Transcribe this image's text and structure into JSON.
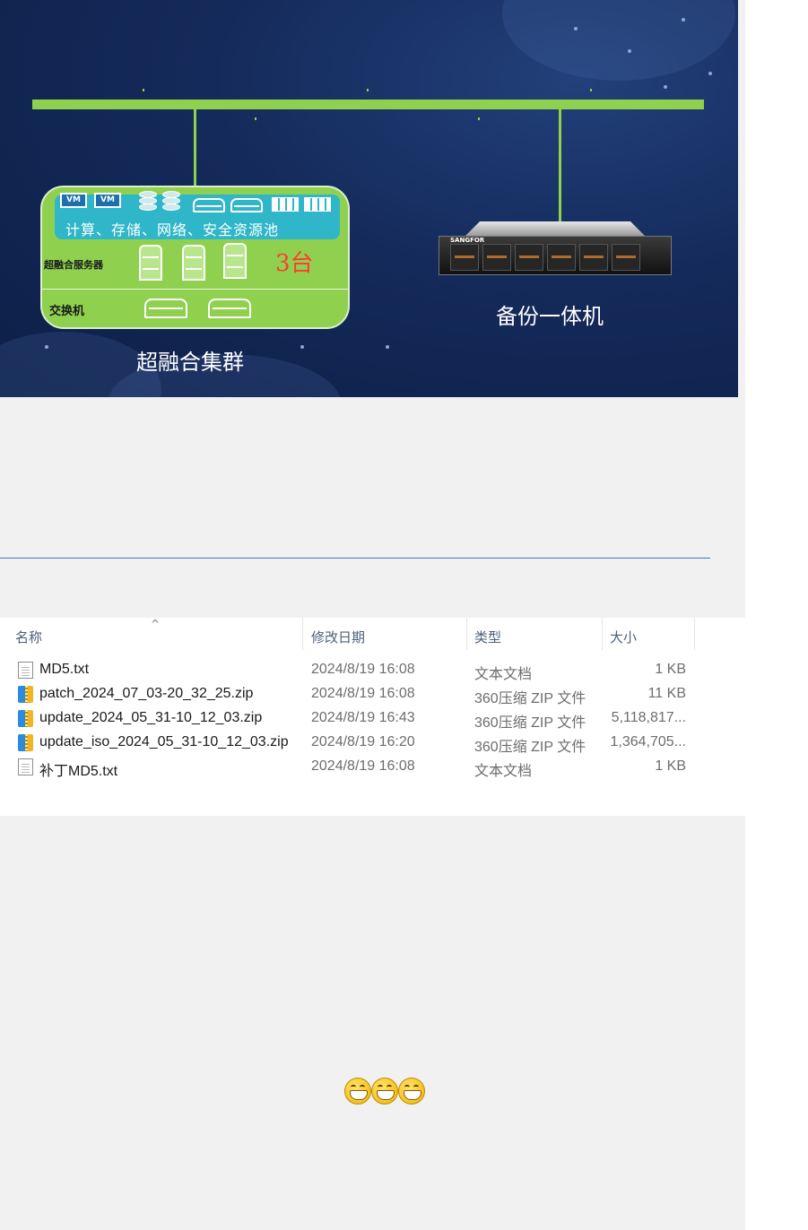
{
  "diagram": {
    "cluster": {
      "pool_label": "计算、存储、网络、安全资源池",
      "servers_label": "超融合服务器",
      "servers_count": "3台",
      "switch_label": "交换机",
      "vm_label": "VM",
      "caption": "超融合集群"
    },
    "appliance": {
      "brand": "SANGFOR",
      "caption": "备份一体机"
    },
    "colors": {
      "bus": "#8fd14f",
      "background": "#142a5a",
      "pool": "#2fb6c8",
      "count": "#ff3b30"
    }
  },
  "explorer": {
    "columns": {
      "name": "名称",
      "date": "修改日期",
      "type": "类型",
      "size": "大小"
    },
    "sort_indicator": "^",
    "files": [
      {
        "icon": "text-file-icon",
        "name": "MD5.txt",
        "date": "2024/8/19 16:08",
        "type": "文本文档",
        "size": "1 KB"
      },
      {
        "icon": "zip-archive-icon",
        "name": "patch_2024_07_03-20_32_25.zip",
        "date": "2024/8/19 16:08",
        "type": "360压缩 ZIP 文件",
        "size": "11 KB"
      },
      {
        "icon": "zip-archive-icon",
        "name": "update_2024_05_31-10_12_03.zip",
        "date": "2024/8/19 16:43",
        "type": "360压缩 ZIP 文件",
        "size": "5,118,817..."
      },
      {
        "icon": "zip-archive-icon",
        "name": "update_iso_2024_05_31-10_12_03.zip",
        "date": "2024/8/19 16:20",
        "type": "360压缩 ZIP 文件",
        "size": "1,364,705..."
      },
      {
        "icon": "text-file-icon",
        "name": "补丁MD5.txt",
        "date": "2024/8/19 16:08",
        "type": "文本文档",
        "size": "1 KB"
      }
    ]
  },
  "emoticons": [
    "grin-emoji-icon",
    "grin-emoji-icon",
    "grin-emoji-icon"
  ]
}
